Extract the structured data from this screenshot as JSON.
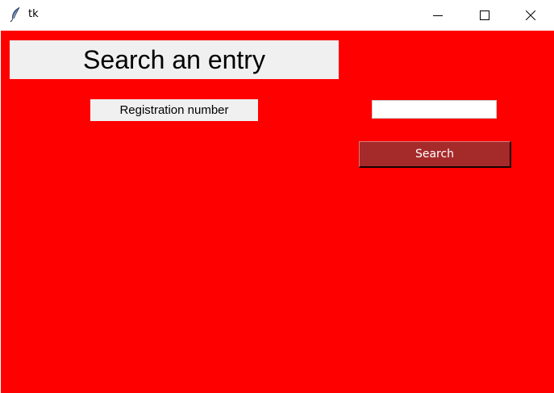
{
  "window": {
    "title": "tk",
    "icons": {
      "app": "feather-icon",
      "minimize": "minimize-icon",
      "maximize": "maximize-icon",
      "close": "close-icon"
    }
  },
  "form": {
    "heading": "Search an entry",
    "registration_label": "Registration number",
    "registration_value": "",
    "search_button": "Search"
  },
  "colors": {
    "background": "#ff0000",
    "label_background": "#f0f0f0",
    "button_background": "#a52a2a",
    "button_text": "#ffffff"
  }
}
